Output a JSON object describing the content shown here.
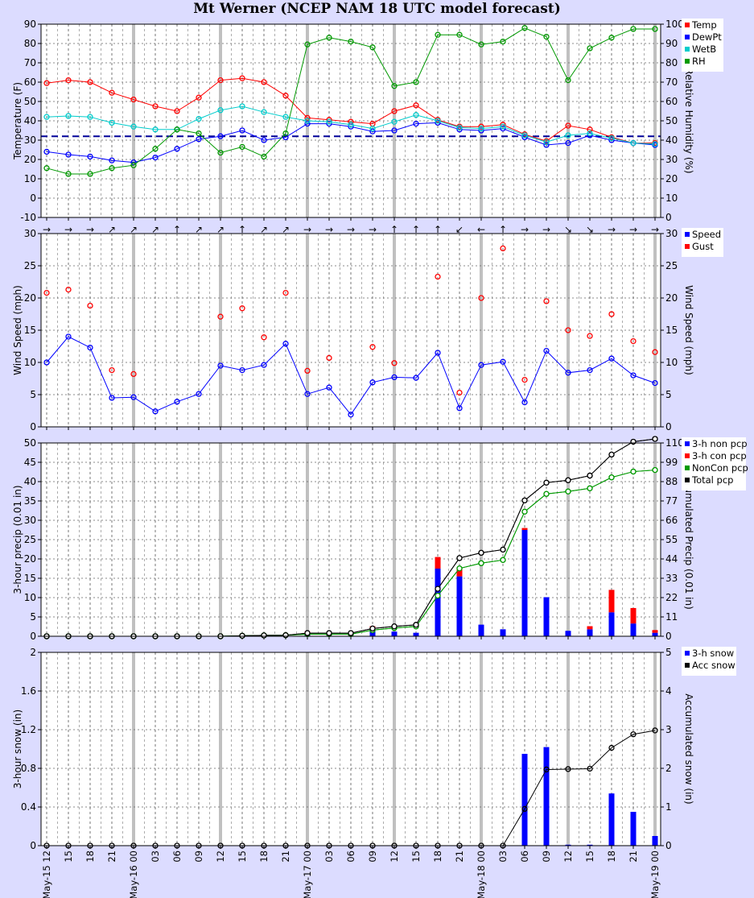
{
  "title": "Mt Werner (NCEP NAM 18 UTC model forecast)",
  "colors": {
    "background": "#dcdcff",
    "plot_bg": "#ffffff",
    "temp": "#ff0000",
    "dewpt": "#0000ff",
    "wetb": "#00cccc",
    "rh": "#009900",
    "speed": "#0000ff",
    "gust": "#ff0000",
    "nonconv": "#0000ff",
    "conv": "#ff0000",
    "noncon_accum": "#009900",
    "total_accum": "#000000",
    "snow": "#0000ff",
    "acc_snow": "#000000",
    "freezing_line": "#000099"
  },
  "time_axis": {
    "labels": [
      "May-15 12",
      "15",
      "18",
      "21",
      "May-16 00",
      "03",
      "06",
      "09",
      "12",
      "15",
      "18",
      "21",
      "May-17 00",
      "03",
      "06",
      "09",
      "12",
      "15",
      "18",
      "21",
      "May-18 00",
      "03",
      "06",
      "09",
      "12",
      "15",
      "18",
      "21",
      "May-19 00"
    ],
    "day_start_indices": [
      4,
      12,
      20,
      28
    ]
  },
  "chart_data": [
    {
      "type": "line",
      "panel": "temperature",
      "ylabel": "Temperature (F)",
      "y2label": "Relative Humidity (%)",
      "ylim": [
        -10,
        90
      ],
      "y2lim": [
        0,
        100
      ],
      "yticks": [
        -10,
        0,
        10,
        20,
        30,
        40,
        50,
        60,
        70,
        80,
        90
      ],
      "y2ticks": [
        0,
        10,
        20,
        30,
        40,
        50,
        60,
        70,
        80,
        90,
        100
      ],
      "freezing_line": 32,
      "series": [
        {
          "name": "Temp",
          "axis": "left",
          "values": [
            59.5,
            61,
            60,
            54.5,
            51,
            47.5,
            45,
            52,
            61,
            62,
            60,
            53,
            41.5,
            40.5,
            39.5,
            38.5,
            45,
            48,
            40.5,
            37,
            37,
            38,
            33,
            29.5,
            37.5,
            35.5,
            31.5,
            28.5,
            28.5
          ]
        },
        {
          "name": "DewPt",
          "axis": "left",
          "values": [
            24,
            22.5,
            21.5,
            19.5,
            18.5,
            21,
            25.5,
            30.5,
            32,
            35,
            30,
            31.5,
            38.5,
            38.5,
            37,
            34.5,
            35,
            38.5,
            39,
            35.5,
            35,
            36,
            31.5,
            27.5,
            28.5,
            32.5,
            30,
            28.5,
            27.5
          ]
        },
        {
          "name": "WetB",
          "axis": "left",
          "values": [
            42,
            42.5,
            42,
            39,
            37,
            35.5,
            35.5,
            41,
            45.5,
            47.5,
            44.5,
            42,
            40,
            39.5,
            38,
            36,
            39.5,
            43,
            40,
            36.5,
            36,
            37,
            32.5,
            29,
            32.5,
            33.5,
            31,
            28.5,
            28
          ]
        },
        {
          "name": "RH",
          "axis": "right",
          "values": [
            25.5,
            22.5,
            22.5,
            25.5,
            27,
            35.5,
            45.5,
            43.5,
            33.5,
            36.5,
            31.5,
            43.5,
            89.5,
            93,
            91,
            88,
            68,
            70,
            94.5,
            94.5,
            89.5,
            91,
            98,
            93.5,
            71,
            87.5,
            93,
            97.5,
            97.5
          ]
        }
      ]
    },
    {
      "type": "line",
      "panel": "wind",
      "ylabel": "Wind Speed (mph)",
      "y2label": "Wind Speed (mph)",
      "ylim": [
        0,
        30
      ],
      "yticks": [
        0,
        5,
        10,
        15,
        20,
        25,
        30
      ],
      "series": [
        {
          "name": "Speed",
          "style": "line",
          "values": [
            10,
            14,
            12.3,
            4.5,
            4.6,
            2.4,
            3.9,
            5.1,
            9.5,
            8.8,
            9.6,
            12.9,
            5.1,
            6.1,
            1.9,
            6.9,
            7.7,
            7.6,
            11.5,
            2.9,
            9.6,
            10.1,
            3.8,
            11.8,
            8.4,
            8.8,
            10.6,
            8,
            6.8
          ]
        },
        {
          "name": "Gust",
          "style": "points",
          "values": [
            20.8,
            21.3,
            18.8,
            8.8,
            8.2,
            null,
            null,
            null,
            17.1,
            18.4,
            13.9,
            20.8,
            8.7,
            10.7,
            null,
            12.4,
            9.9,
            null,
            23.3,
            5.3,
            20,
            27.7,
            7.3,
            19.5,
            15,
            14.1,
            17.5,
            13.3,
            11.6
          ]
        }
      ],
      "wind_direction_arrows": [
        "→",
        "→",
        "→",
        "↗",
        "↗",
        "↗",
        "↑",
        "↗",
        "↗",
        "↑",
        "↗",
        "↗",
        "→",
        "→",
        "→",
        "→",
        "↑",
        "↑",
        "↑",
        "↙",
        "←",
        "↑",
        "→",
        "→",
        "↘",
        "↘",
        "→",
        "→",
        "→"
      ]
    },
    {
      "type": "bar",
      "panel": "precip",
      "ylabel": "3-hour precip (0.01 in)",
      "y2label": "Accumulated Precip (0.01 in)",
      "ylim": [
        0,
        50
      ],
      "y2lim": [
        0,
        110
      ],
      "yticks": [
        0,
        5,
        10,
        15,
        20,
        25,
        30,
        35,
        40,
        45,
        50
      ],
      "y2ticks": [
        0,
        11,
        22,
        33,
        44,
        55,
        66,
        77,
        88,
        99,
        110
      ],
      "series": [
        {
          "name": "3-h non pcp",
          "style": "stacked-bar",
          "values": [
            0,
            0,
            0,
            0,
            0,
            0,
            0,
            0,
            0,
            0.3,
            0.2,
            0.1,
            0.6,
            0,
            0,
            2.3,
            1.2,
            0.9,
            17.5,
            15.5,
            3,
            1.8,
            27.5,
            10.1,
            1.4,
            1.8,
            6.2,
            3.3,
            0.9
          ]
        },
        {
          "name": "3-h con pcp",
          "style": "stacked-bar",
          "values": [
            0,
            0,
            0,
            0,
            0,
            0,
            0,
            0,
            0,
            0,
            0,
            0,
            0.6,
            0,
            0,
            0.3,
            0,
            0,
            3,
            2,
            0,
            0,
            0.5,
            0,
            0,
            0.8,
            5.8,
            4,
            0.7
          ]
        },
        {
          "name": "NonCon pcp",
          "style": "accum-line",
          "values": [
            0,
            0,
            0,
            0,
            0,
            0,
            0,
            0,
            0,
            0.3,
            0.5,
            0.6,
            1.2,
            1.2,
            1.2,
            3.5,
            4.7,
            5.6,
            23.1,
            38.6,
            41.6,
            43.4,
            70.9,
            81,
            82.4,
            84.2,
            90.4,
            93.7,
            94.6
          ]
        },
        {
          "name": "Total pcp",
          "style": "accum-line",
          "values": [
            0,
            0,
            0,
            0,
            0,
            0,
            0,
            0,
            0,
            0.3,
            0.5,
            0.6,
            1.8,
            1.8,
            1.8,
            4.4,
            5.6,
            6.5,
            27,
            44.5,
            47.5,
            49.3,
            77.3,
            87.4,
            88.8,
            91.4,
            103.4,
            110.7,
            112.3
          ]
        }
      ]
    },
    {
      "type": "bar",
      "panel": "snow",
      "ylabel": "3-hour snow (in)",
      "y2label": "Accumulated snow (in)",
      "ylim": [
        0,
        2
      ],
      "y2lim": [
        0,
        5
      ],
      "yticks": [
        "0",
        "0.4",
        "0.8",
        "1.2",
        "1.6",
        "2"
      ],
      "y2ticks": [
        "0",
        "1",
        "2",
        "3",
        "4",
        "5"
      ],
      "series": [
        {
          "name": "3-h snow",
          "style": "bar",
          "values": [
            0,
            0,
            0,
            0,
            0,
            0,
            0,
            0,
            0,
            0,
            0,
            0,
            0,
            0,
            0,
            0,
            0,
            0,
            0,
            0,
            0,
            0,
            0.95,
            1.02,
            0.01,
            0.01,
            0.54,
            0.35,
            0.1
          ]
        },
        {
          "name": "Acc snow",
          "style": "accum-line",
          "values": [
            0,
            0,
            0,
            0,
            0,
            0,
            0,
            0,
            0,
            0,
            0,
            0,
            0,
            0,
            0,
            0,
            0,
            0,
            0,
            0,
            0,
            0,
            0.95,
            1.97,
            1.98,
            1.99,
            2.53,
            2.88,
            2.98
          ]
        }
      ]
    }
  ]
}
